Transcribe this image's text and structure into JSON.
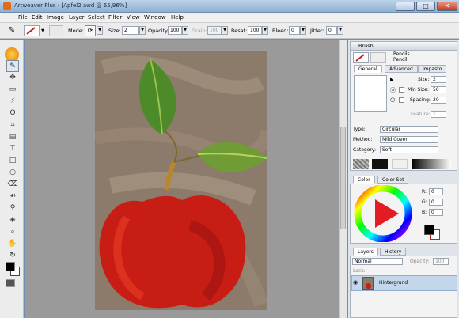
{
  "window": {
    "title": "Artweaver Plus - [Apfel2.awd @ 65,96%]",
    "minimize": "–",
    "maximize": "□",
    "close": "✕"
  },
  "menu": [
    "File",
    "Edit",
    "Image",
    "Layer",
    "Select",
    "Filter",
    "View",
    "Window",
    "Help"
  ],
  "options": {
    "mode_label": "Mode:",
    "size_label": "Size:",
    "size_value": "2",
    "opacity_label": "Opacity:",
    "opacity_value": "100",
    "grain_label": "Grain:",
    "grain_value": "100",
    "resat_label": "Resat:",
    "resat_value": "100",
    "bleed_label": "Bleed:",
    "bleed_value": "0",
    "jitter_label": "Jitter:",
    "jitter_value": "0"
  },
  "brush_panel": {
    "title": "Brush",
    "category_primary": "Pencils",
    "category_secondary": "Pencil",
    "tabs": [
      "General",
      "Advanced",
      "Impasto"
    ],
    "size_label": "Size:",
    "size_value": "2",
    "min_size_label": "Min Size:",
    "min_size_value": "50",
    "spacing_label": "Spacing:",
    "spacing_value": "20",
    "feature_label": "Feature:",
    "feature_value": "1",
    "type_label": "Type:",
    "type_value": "Circular",
    "method_label": "Method:",
    "method_value": "Mild Cover",
    "category_label": "Category:",
    "category_value": "Soft"
  },
  "color_panel": {
    "tabs": [
      "Color",
      "Color Set"
    ],
    "r_label": "R:",
    "r_value": "0",
    "g_label": "G:",
    "g_value": "0",
    "b_label": "B:",
    "b_value": "0"
  },
  "layers_panel": {
    "tabs": [
      "Layers",
      "History"
    ],
    "blend_mode": "Normal",
    "opacity_label": "Opacity:",
    "opacity_value": "100",
    "lock_label": "Lock:",
    "layer_name": "Hintergrund"
  },
  "colors": {
    "accent": "#c3d6ea",
    "foreground": "#000000",
    "background_swatch": "#ffffff"
  }
}
